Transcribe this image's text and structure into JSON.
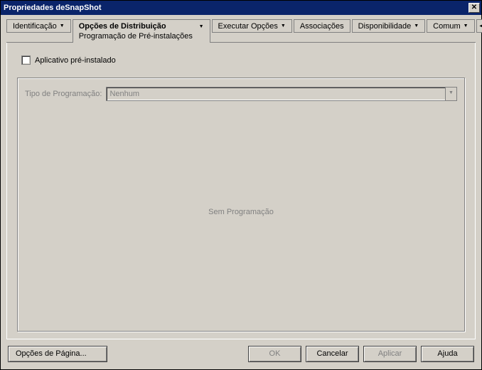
{
  "window": {
    "title": "Propriedades deSnapShot"
  },
  "tabs": {
    "identificacao": "Identificação",
    "opcoes_distribuicao": "Opções de Distribuição",
    "opcoes_distribuicao_sub": "Programação de Pré-instalações",
    "executar_opcoes": "Executar Opções",
    "associacoes": "Associações",
    "disponibilidade": "Disponibilidade",
    "comum": "Comum"
  },
  "content": {
    "preinstalled_label": "Aplicativo pré-instalado",
    "schedule_type_label": "Tipo de Programação:",
    "schedule_type_value": "Nenhum",
    "placeholder": "Sem Programação"
  },
  "buttons": {
    "page_options": "Opções de Página...",
    "ok": "OK",
    "cancel": "Cancelar",
    "apply": "Aplicar",
    "help": "Ajuda"
  }
}
